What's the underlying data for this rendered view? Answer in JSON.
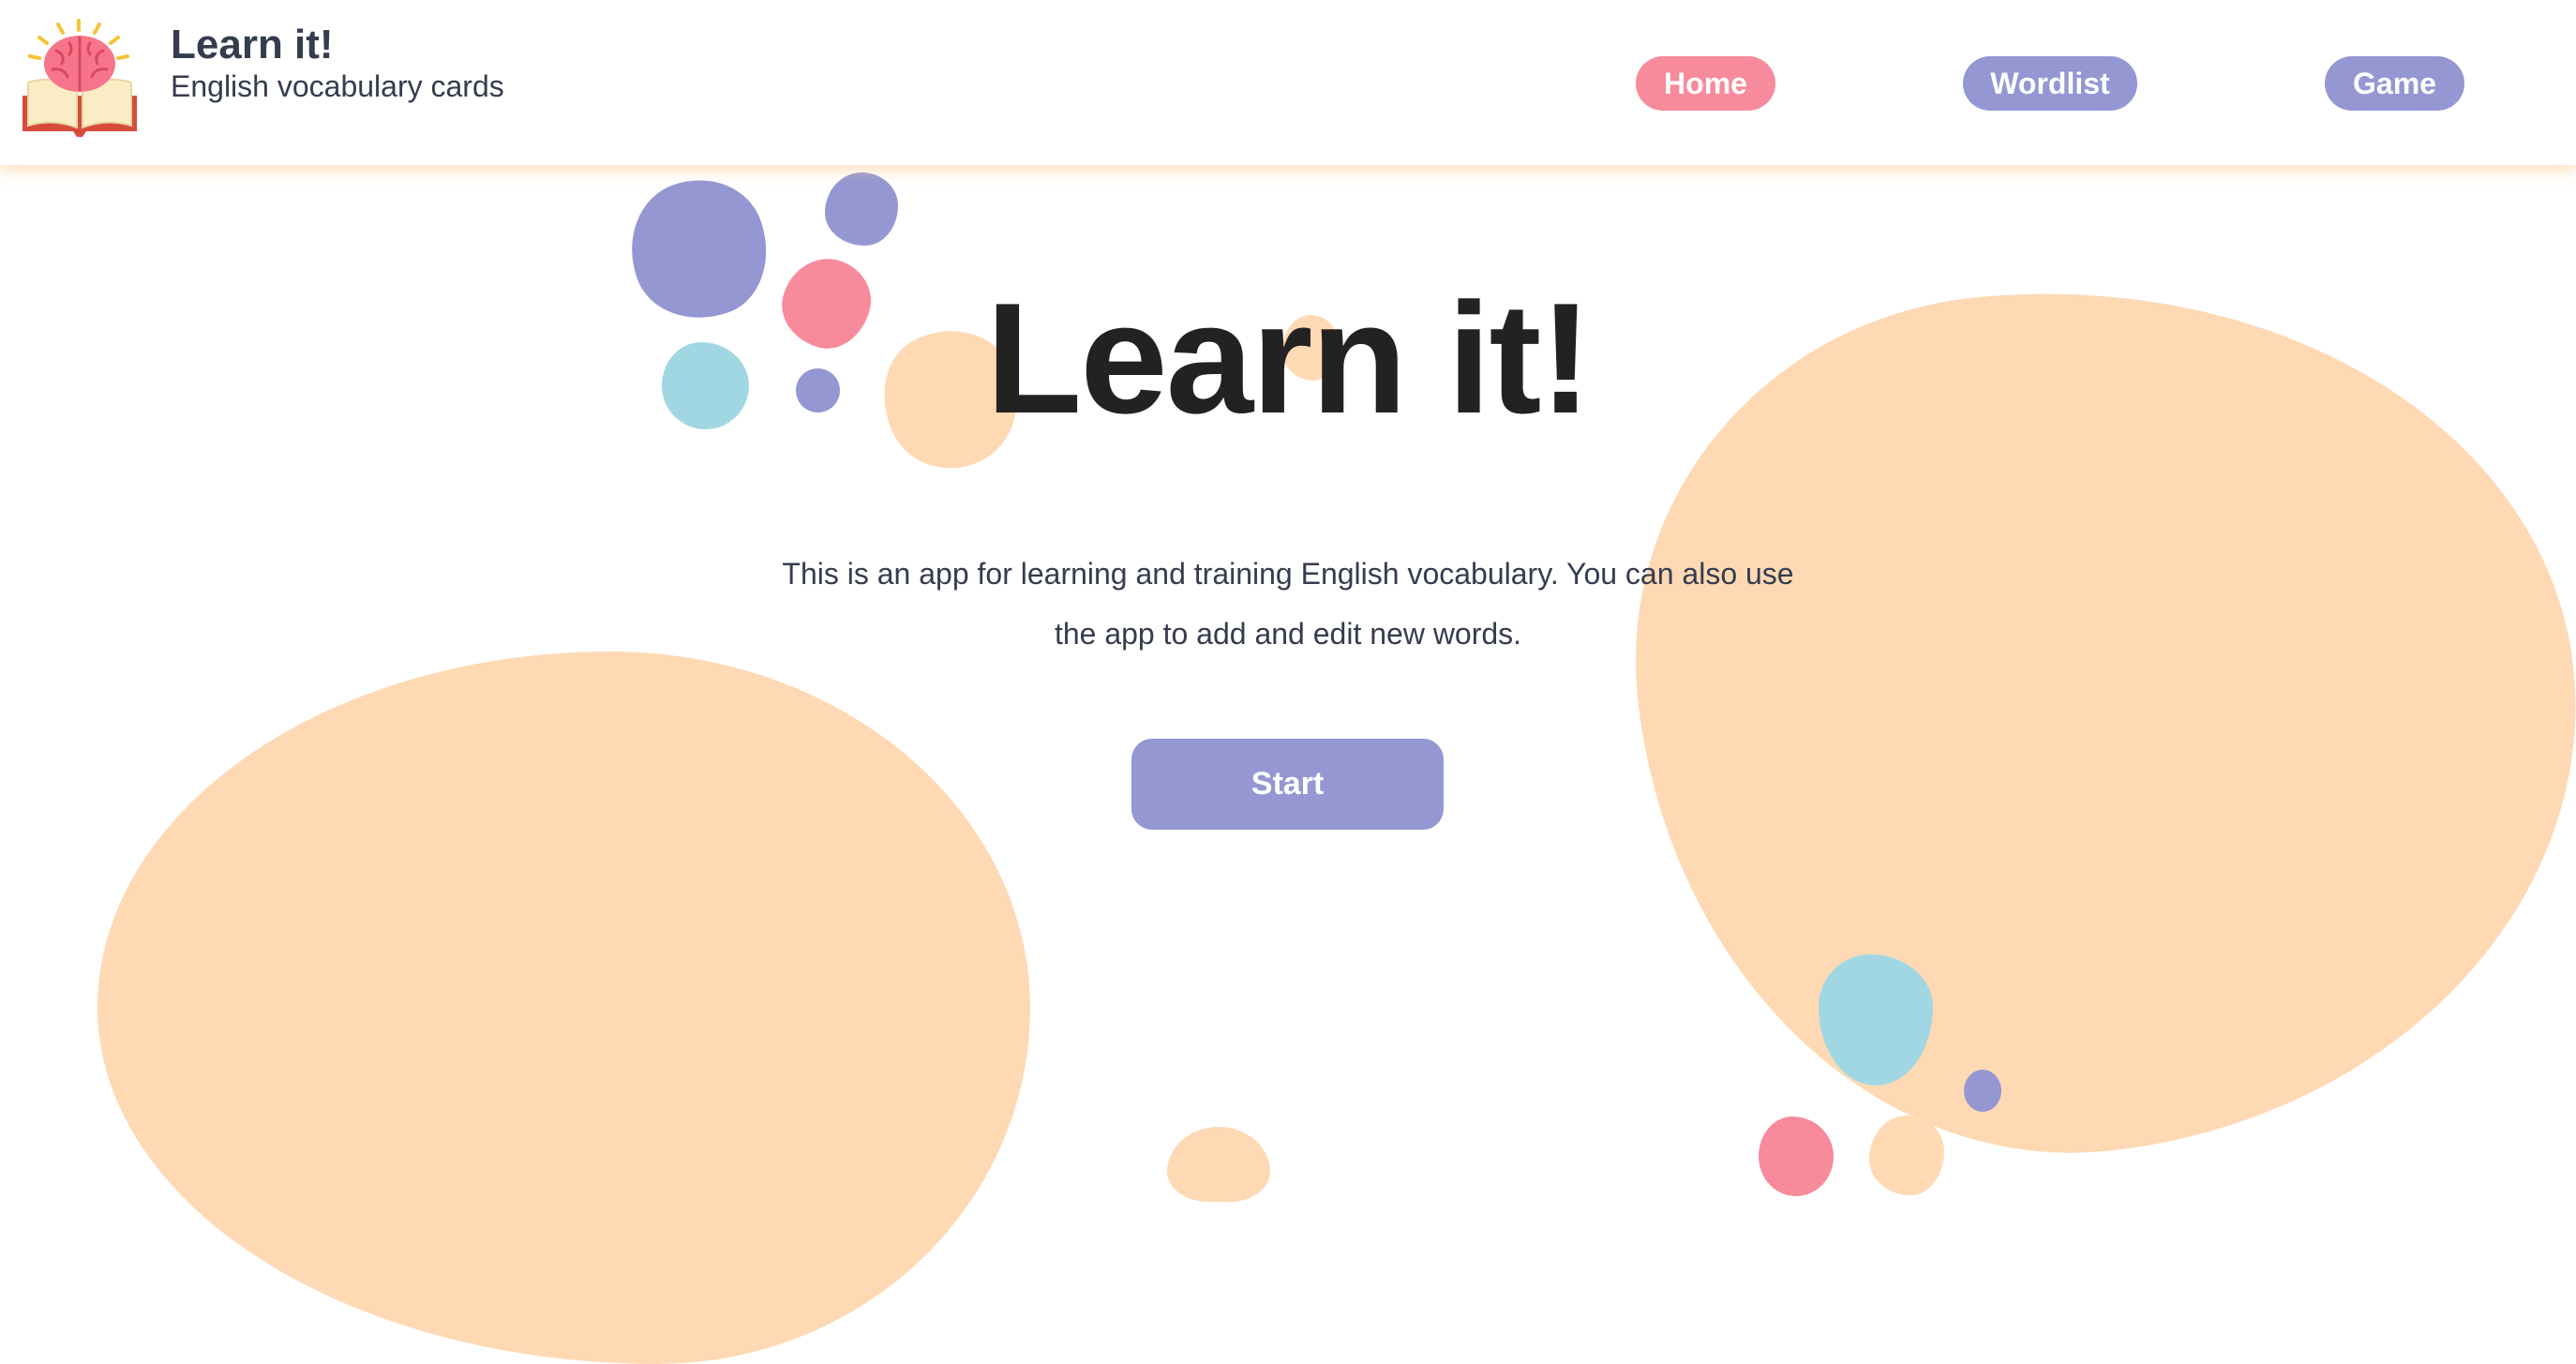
{
  "header": {
    "title": "Learn it!",
    "subtitle": "English vocabulary cards",
    "logo_icon": "book-brain-icon"
  },
  "nav": {
    "items": [
      {
        "label": "Home",
        "active": true,
        "color": "#f78a9b"
      },
      {
        "label": "Wordlist",
        "active": false,
        "color": "#9497d2"
      },
      {
        "label": "Game",
        "active": false,
        "color": "#9497d2"
      }
    ]
  },
  "hero": {
    "title": "Learn it!",
    "description": "This is an app for learning and training English vocabulary. You can also use the app to add and edit new words.",
    "start_label": "Start"
  },
  "colors": {
    "primary": "#9497d2",
    "accent_pink": "#f78a9b",
    "peach": "#fed9b4",
    "teal": "#a1d7e3",
    "text_dark": "#222222",
    "text_muted": "#353c4e"
  }
}
